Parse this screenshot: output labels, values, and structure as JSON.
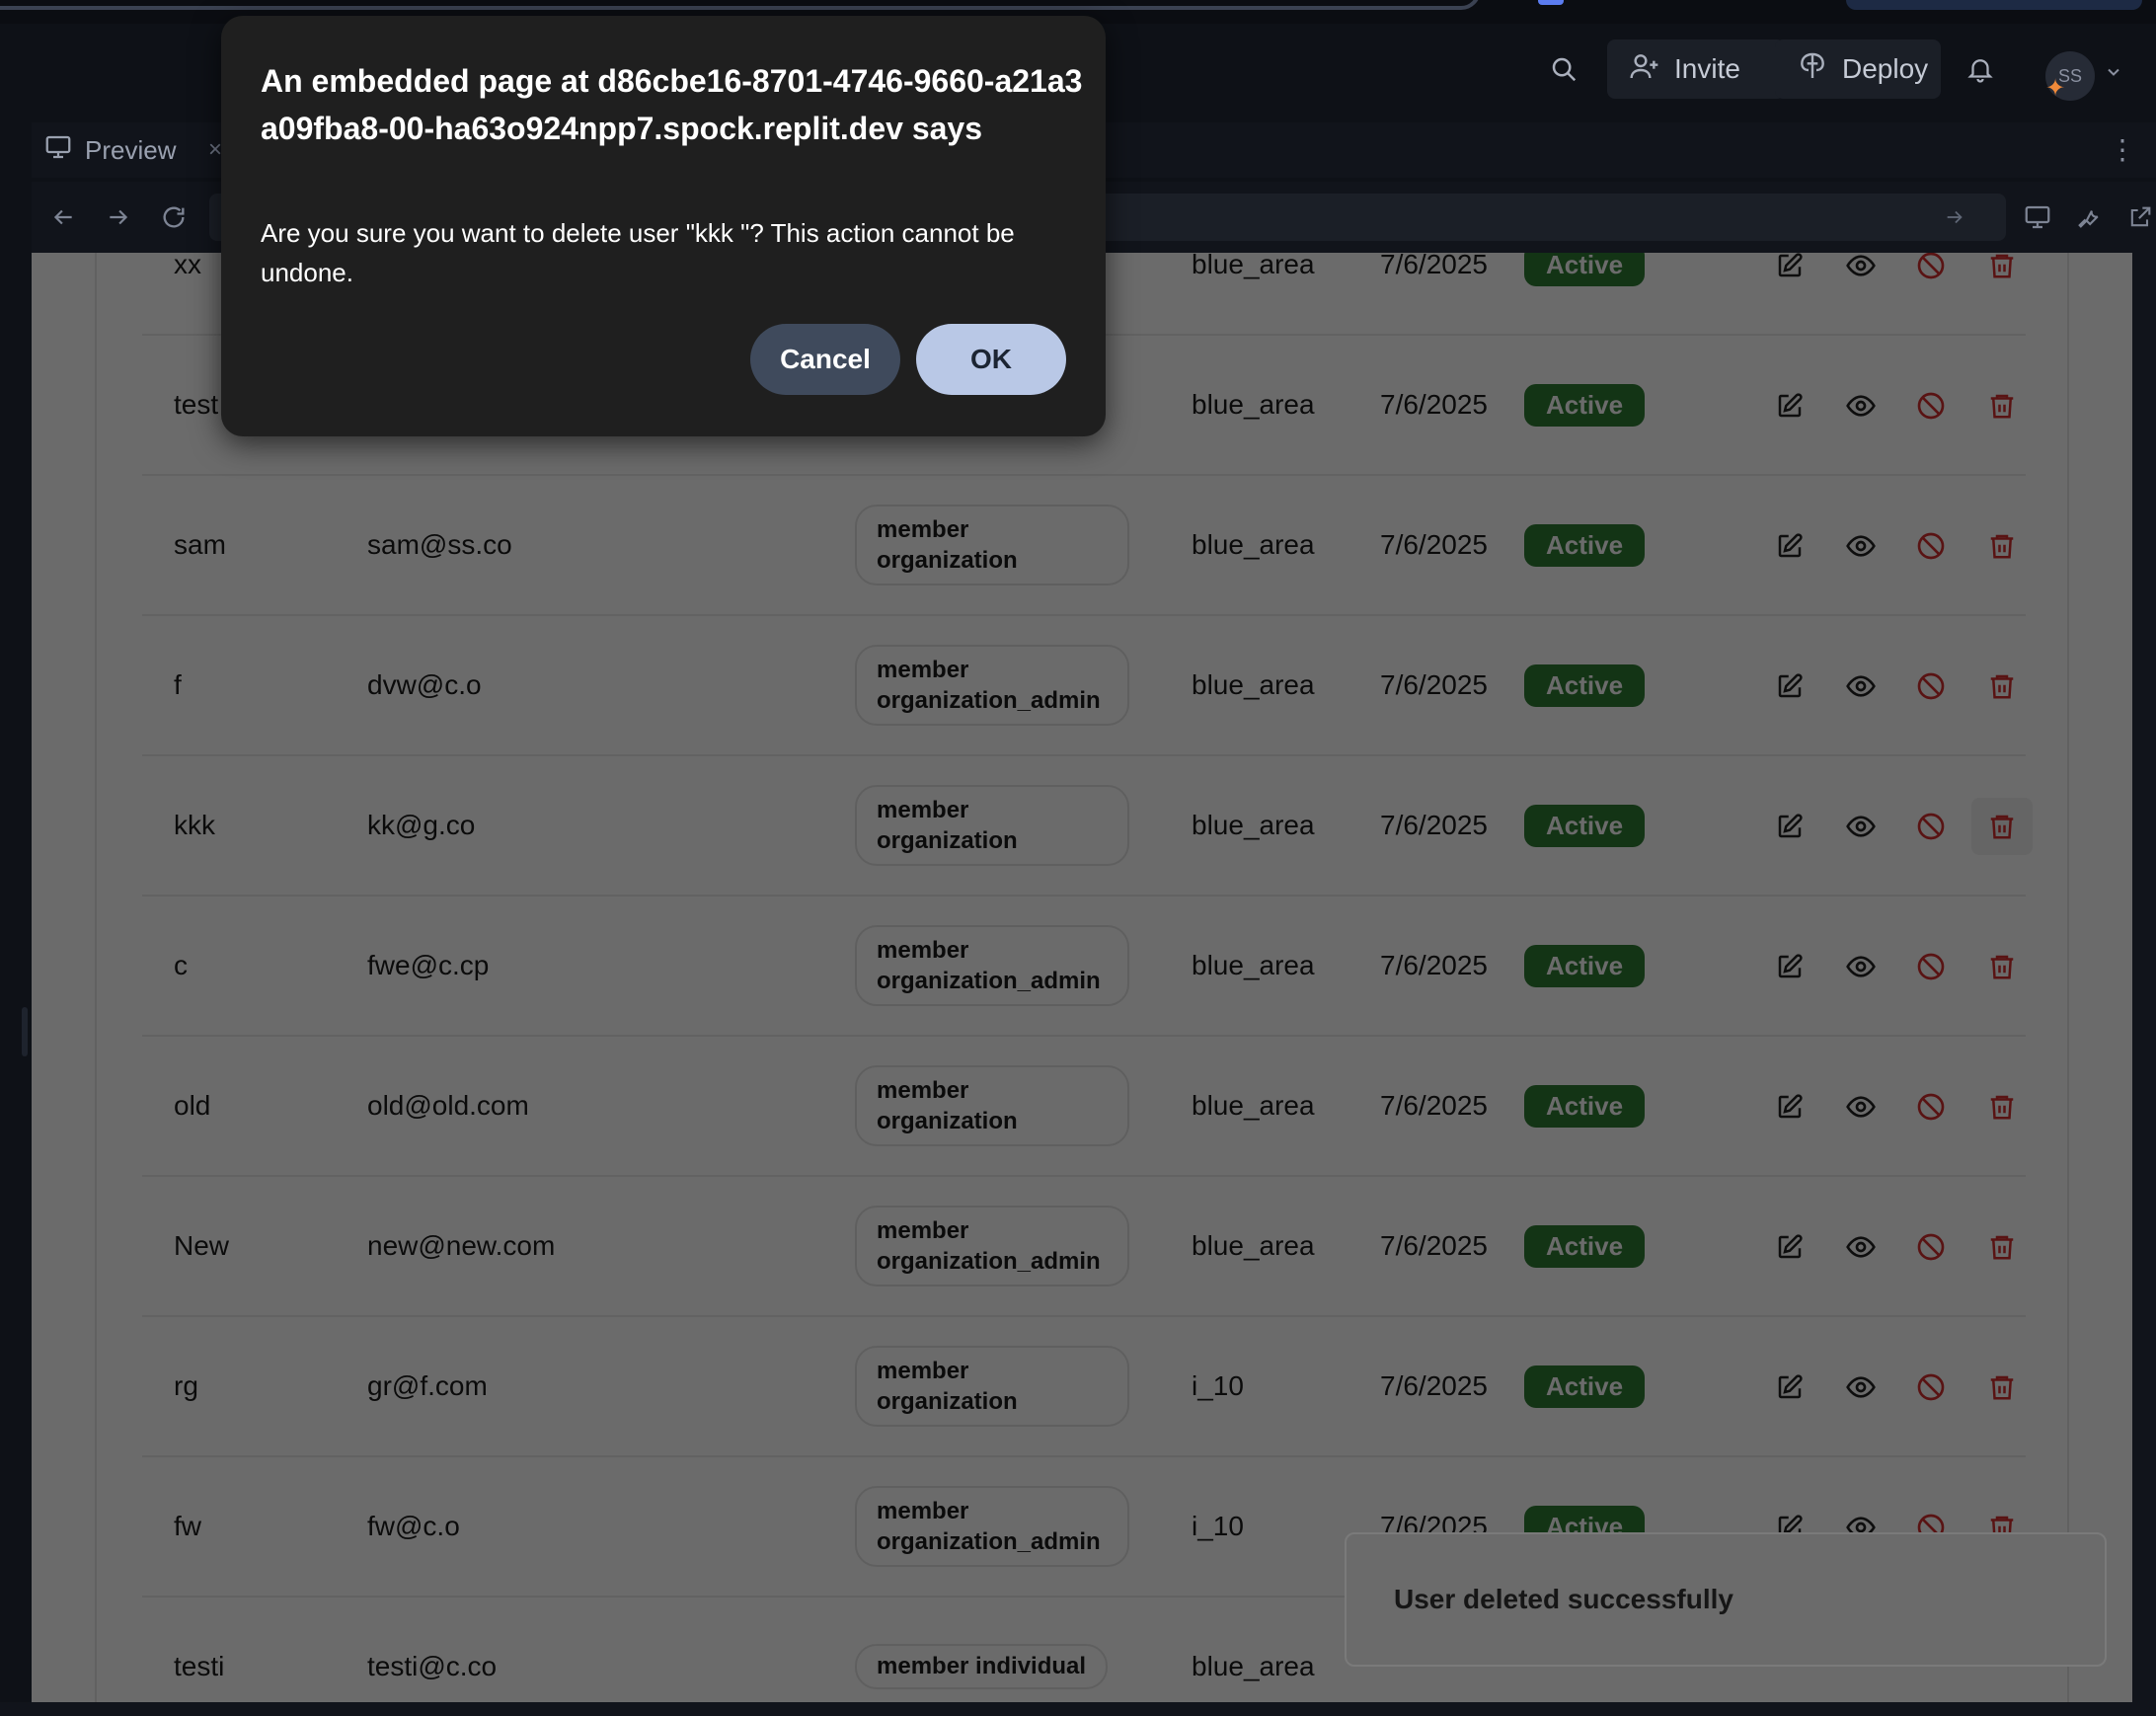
{
  "ide": {
    "header": {
      "invite_label": "Invite",
      "deploy_label": "Deploy",
      "avatar_initials": "SS"
    },
    "tab": {
      "label": "Preview",
      "close": "×"
    }
  },
  "table": {
    "rows": [
      {
        "name": "xx",
        "email": "",
        "roles": "",
        "area": "blue_area",
        "date": "7/6/2025",
        "status": "Active"
      },
      {
        "name": "test",
        "email": "",
        "roles": "",
        "area": "blue_area",
        "date": "7/6/2025",
        "status": "Active"
      },
      {
        "name": "sam",
        "email": "sam@ss.co",
        "roles": "member\norganization",
        "area": "blue_area",
        "date": "7/6/2025",
        "status": "Active"
      },
      {
        "name": "f",
        "email": "dvw@c.o",
        "roles": "member\norganization_admin",
        "area": "blue_area",
        "date": "7/6/2025",
        "status": "Active"
      },
      {
        "name": "kkk",
        "email": "kk@g.co",
        "roles": "member\norganization",
        "area": "blue_area",
        "date": "7/6/2025",
        "status": "Active"
      },
      {
        "name": "c",
        "email": "fwe@c.cp",
        "roles": "member\norganization_admin",
        "area": "blue_area",
        "date": "7/6/2025",
        "status": "Active"
      },
      {
        "name": "old",
        "email": "old@old.com",
        "roles": "member\norganization",
        "area": "blue_area",
        "date": "7/6/2025",
        "status": "Active"
      },
      {
        "name": "New",
        "email": "new@new.com",
        "roles": "member\norganization_admin",
        "area": "blue_area",
        "date": "7/6/2025",
        "status": "Active"
      },
      {
        "name": "rg",
        "email": "gr@f.com",
        "roles": "member\norganization",
        "area": "i_10",
        "date": "7/6/2025",
        "status": "Active"
      },
      {
        "name": "fw",
        "email": "fw@c.o",
        "roles": "member\norganization_admin",
        "area": "i_10",
        "date": "7/6/2025",
        "status": "Active"
      },
      {
        "name": "testi",
        "email": "testi@c.co",
        "roles": "member individual",
        "area": "blue_area",
        "date": "",
        "status": ""
      }
    ]
  },
  "toast": {
    "message": "User deleted successfully"
  },
  "dialog": {
    "title": "An embedded page at d86cbe16-8701-4746-9660-a21a3a09fba8-00-ha63o924npp7.spock.replit.dev says",
    "message": "Are you sure you want to delete user \"kkk \"? This action cannot be undone.",
    "cancel_label": "Cancel",
    "ok_label": "OK"
  },
  "colors": {
    "status_active": "#2e7d32",
    "delete_red": "#d32f2f",
    "dialog_bg": "#1f1f1f",
    "ok_button": "#b9c8e6",
    "cancel_button": "#3f4a5c"
  },
  "icons": {
    "row_actions": [
      "edit-icon",
      "eye-icon",
      "ban-icon",
      "trash-icon"
    ],
    "header": [
      "search-icon",
      "add-user-icon",
      "deploy-icon",
      "bell-icon",
      "chevron-down-icon"
    ],
    "browser": [
      "back-arrow-icon",
      "forward-arrow-icon",
      "reload-icon",
      "arrow-right-icon",
      "monitor-icon",
      "wrench-icon",
      "external-link-icon"
    ]
  }
}
